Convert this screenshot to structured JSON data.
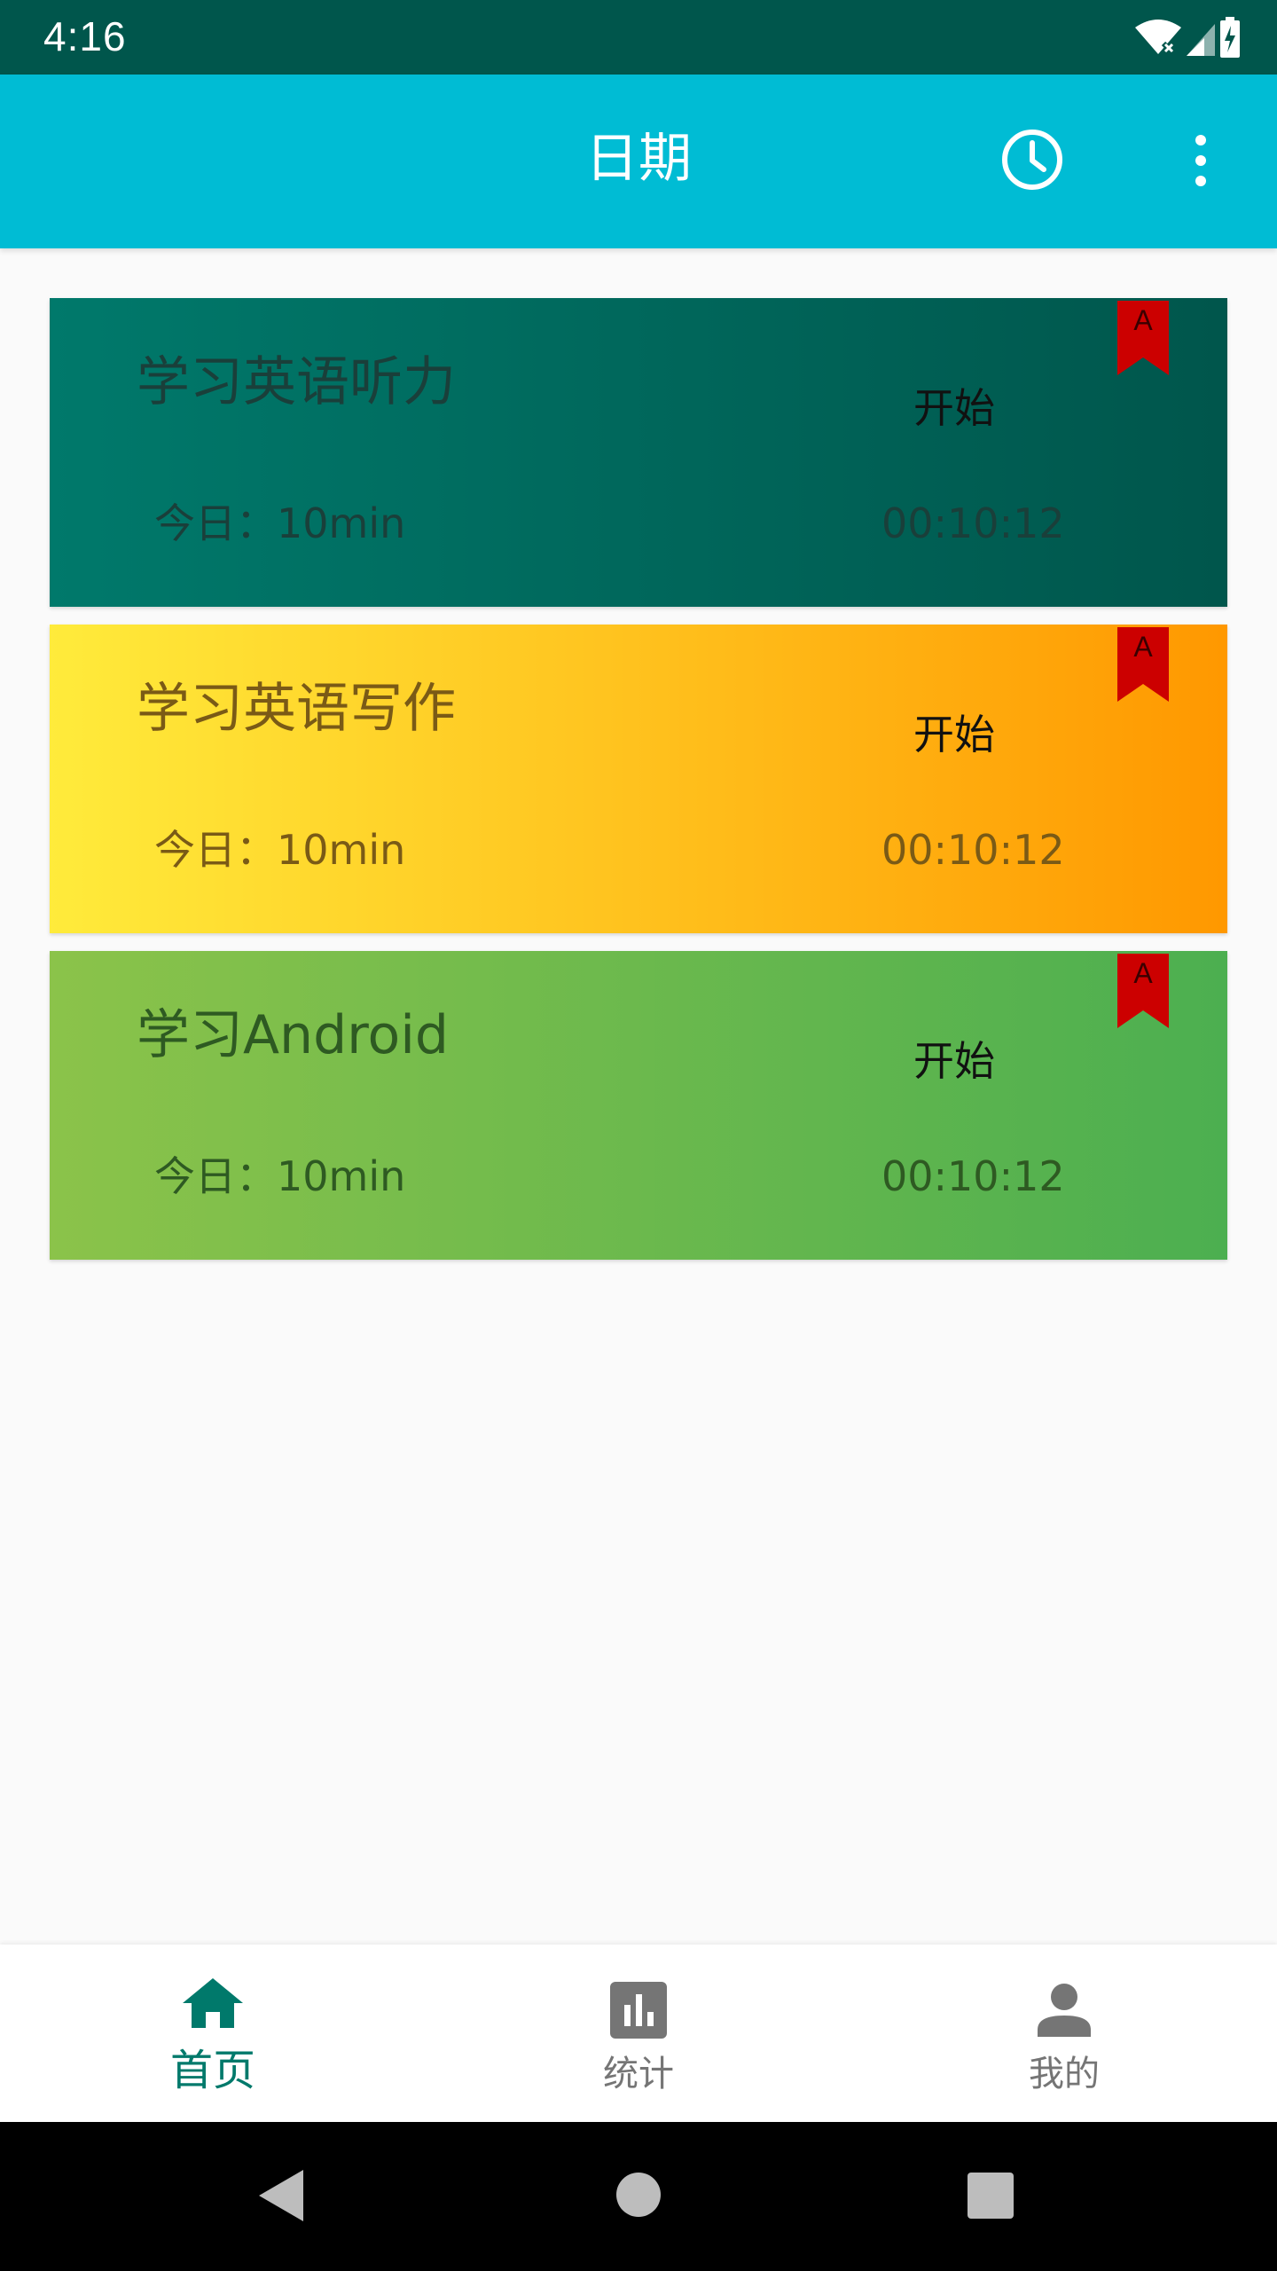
{
  "status_bar": {
    "time": "4:16",
    "icons": [
      "wifi-off-icon",
      "signal-icon",
      "battery-charging-icon"
    ]
  },
  "app_bar": {
    "title": "日期",
    "actions": [
      "clock-icon",
      "more-vert-icon"
    ]
  },
  "tasks": [
    {
      "title": "学习英语听力",
      "action_label": "开始",
      "today_label": "今日：",
      "today_value": "10min",
      "timer": "00:10:12",
      "ribbon_letter": "A",
      "gradient": [
        "#00796b",
        "#00564c"
      ]
    },
    {
      "title": "学习英语写作",
      "action_label": "开始",
      "today_label": "今日：",
      "today_value": "10min",
      "timer": "00:10:12",
      "ribbon_letter": "A",
      "gradient": [
        "#ffeb3b",
        "#ff9800"
      ]
    },
    {
      "title": "学习Android",
      "action_label": "开始",
      "today_label": "今日：",
      "today_value": "10min",
      "timer": "00:10:12",
      "ribbon_letter": "A",
      "gradient": [
        "#8bc34a",
        "#4caf50"
      ]
    }
  ],
  "bottom_nav": {
    "items": [
      {
        "label": "首页",
        "icon": "home-icon",
        "active": true
      },
      {
        "label": "统计",
        "icon": "bar-chart-icon",
        "active": false
      },
      {
        "label": "我的",
        "icon": "person-icon",
        "active": false
      }
    ]
  },
  "system_nav": {
    "buttons": [
      "back-icon",
      "home-circle-icon",
      "recents-icon"
    ]
  },
  "colors": {
    "status_bar": "#00564c",
    "app_bar": "#00bcd4",
    "accent": "#00796b",
    "ribbon": "#cc0000",
    "nav_inactive": "#757575"
  }
}
